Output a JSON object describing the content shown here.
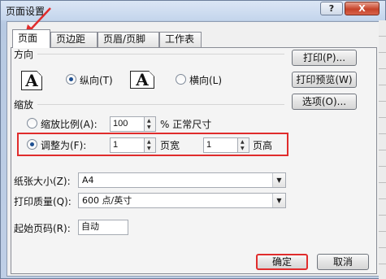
{
  "window": {
    "title": "页面设置",
    "help_label": "?",
    "close_label": "X"
  },
  "tabs": [
    {
      "label": "页面",
      "active": true
    },
    {
      "label": "页边距",
      "active": false
    },
    {
      "label": "页眉/页脚",
      "active": false
    },
    {
      "label": "工作表",
      "active": false
    }
  ],
  "orientation": {
    "heading": "方向",
    "icon_letter": "A",
    "portrait_label": "纵向(T)",
    "landscape_label": "横向(L)",
    "selected": "portrait"
  },
  "scaling": {
    "heading": "缩放",
    "adjust_to_label": "缩放比例(A):",
    "adjust_to_value": "100",
    "adjust_to_suffix": "% 正常尺寸",
    "fit_to_label": "调整为(F):",
    "fit_pages_wide": "1",
    "fit_wide_suffix": "页宽",
    "fit_pages_tall": "1",
    "fit_tall_suffix": "页高",
    "selected": "fit_to"
  },
  "paper_size": {
    "label": "纸张大小(Z):",
    "value": "A4"
  },
  "print_quality": {
    "label": "打印质量(Q):",
    "value": "600 点/英寸"
  },
  "first_page_number": {
    "label": "起始页码(R):",
    "value": "自动"
  },
  "side_buttons": {
    "print": "打印(P)...",
    "print_preview": "打印预览(W)",
    "options": "选项(O)..."
  },
  "footer": {
    "ok": "确定",
    "cancel": "取消"
  },
  "colors": {
    "highlight": "#e02c2c",
    "selected_radio": "#1d4f91"
  }
}
